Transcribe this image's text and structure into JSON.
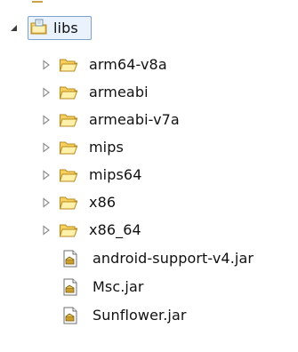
{
  "tree": {
    "root": {
      "label": "libs",
      "expanded": true,
      "selected": true,
      "icon": "package-folder-icon"
    },
    "children": [
      {
        "label": "arm64-v8a",
        "type": "folder",
        "expanded": false,
        "icon": "folder-icon"
      },
      {
        "label": "armeabi",
        "type": "folder",
        "expanded": false,
        "icon": "folder-icon"
      },
      {
        "label": "armeabi-v7a",
        "type": "folder",
        "expanded": false,
        "icon": "folder-icon"
      },
      {
        "label": "mips",
        "type": "folder",
        "expanded": false,
        "icon": "folder-icon"
      },
      {
        "label": "mips64",
        "type": "folder",
        "expanded": false,
        "icon": "folder-icon"
      },
      {
        "label": "x86",
        "type": "folder",
        "expanded": false,
        "icon": "folder-icon"
      },
      {
        "label": "x86_64",
        "type": "folder",
        "expanded": false,
        "icon": "folder-icon"
      },
      {
        "label": "android-support-v4.jar",
        "type": "file",
        "icon": "jar-file-icon"
      },
      {
        "label": "Msc.jar",
        "type": "file",
        "icon": "jar-file-icon"
      },
      {
        "label": "Sunflower.jar",
        "type": "file",
        "icon": "jar-file-icon"
      }
    ]
  },
  "colors": {
    "folder_fill": "#f5d05d",
    "folder_stroke": "#b9891e",
    "selection_border": "#7da2ce",
    "selection_bg": "#eaf3fd",
    "toggle_color": "#8a8a8a",
    "text": "#111111"
  }
}
